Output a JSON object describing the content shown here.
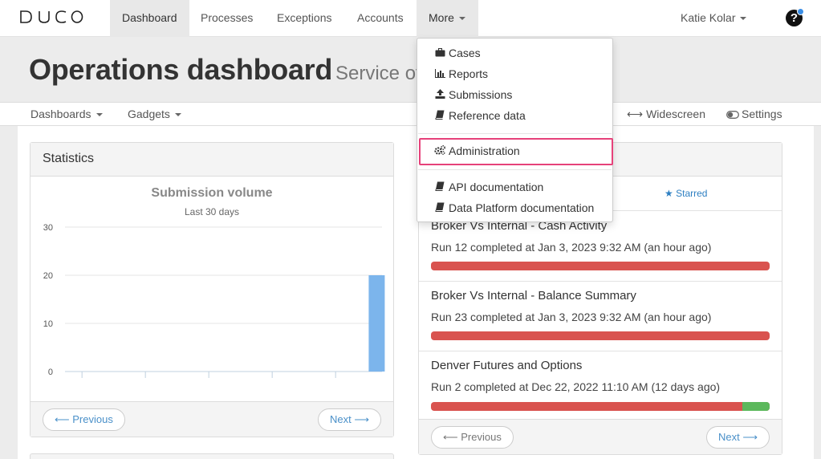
{
  "brand": {
    "logo_text": "DUCO"
  },
  "nav": {
    "items": [
      {
        "label": "Dashboard"
      },
      {
        "label": "Processes"
      },
      {
        "label": "Exceptions"
      },
      {
        "label": "Accounts"
      },
      {
        "label": "More"
      }
    ],
    "user": "Katie Kolar",
    "help_icon": "question-circle-icon"
  },
  "header": {
    "title": "Operations dashboard",
    "subtitle": "Service ov"
  },
  "subnav": {
    "dashboards": "Dashboards",
    "gadgets": "Gadgets",
    "widescreen": "Widescreen",
    "settings": "Settings"
  },
  "statistics": {
    "title": "Statistics",
    "prev": "Previous",
    "next": "Next"
  },
  "chart_data": {
    "type": "bar",
    "title": "Submission volume",
    "subtitle": "Last 30 days",
    "yticks": [
      0,
      10,
      20,
      30
    ],
    "ylim": [
      0,
      30
    ],
    "x_count": 30,
    "values": [
      0,
      0,
      0,
      0,
      0,
      0,
      0,
      0,
      0,
      0,
      0,
      0,
      0,
      0,
      0,
      0,
      0,
      0,
      0,
      0,
      0,
      0,
      0,
      0,
      0,
      0,
      0,
      0,
      0,
      20
    ],
    "bar_color": "#7cb5ec",
    "grid": true
  },
  "processes": {
    "starred_label": "Starred",
    "runs": [
      {
        "name": "Broker Vs Internal - Cash Activity",
        "desc": "Run 12 completed at Jan 3, 2023 9:32 AM (an hour ago)",
        "ok_fraction": 0
      },
      {
        "name": "Broker Vs Internal - Balance Summary",
        "desc": "Run 23 completed at Jan 3, 2023 9:32 AM (an hour ago)",
        "ok_fraction": 0
      },
      {
        "name": "Denver Futures and Options",
        "desc": "Run 2 completed at Dec 22, 2022 11:10 AM (12 days ago)",
        "ok_fraction": 0.08
      }
    ],
    "prev": "Previous",
    "next": "Next",
    "colors": {
      "fail": "#d9534f",
      "ok": "#5cb85c"
    }
  },
  "more_menu": {
    "items": [
      {
        "label": "Cases",
        "icon": "briefcase-icon"
      },
      {
        "label": "Reports",
        "icon": "bar-chart-icon"
      },
      {
        "label": "Submissions",
        "icon": "upload-icon"
      },
      {
        "label": "Reference data",
        "icon": "book-icon"
      },
      {
        "label": "Administration",
        "icon": "gears-icon"
      },
      {
        "label": "API documentation",
        "icon": "book-icon"
      },
      {
        "label": "Data Platform documentation",
        "icon": "book-icon"
      }
    ],
    "highlight_color": "#e6417a"
  }
}
